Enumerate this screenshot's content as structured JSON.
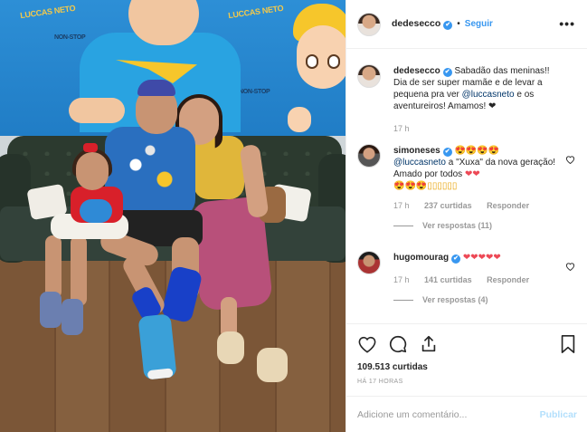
{
  "photo": {
    "banner_words": [
      "LUCCAS NETO",
      "NON-STOP",
      "LUCCAS NETO",
      "NON-STOP"
    ]
  },
  "header": {
    "username": "dedesecco",
    "verified": "✔",
    "separator": "•",
    "follow_label": "Seguir",
    "more_label": "•••"
  },
  "caption": {
    "username": "dedesecco",
    "verified": "✔",
    "text_1": "Sabadão das meninas!! Dia de ser super mamãe e de levar a pequena pra ver ",
    "mention": "@luccasneto",
    "text_2": " e os aventureiros! Amamos! ",
    "emoji": "❤",
    "time": "17 h"
  },
  "comments": [
    {
      "username": "simoneses",
      "verified": "✔",
      "emoji_lead": "😍😍😍😍",
      "mention": "@luccasneto",
      "text": " a \"Xuxa\" da nova geração! Amado por todos ",
      "emoji_hearts": "❤❤",
      "emoji_tail": "😍😍😍▯▯▯▯▯▯",
      "time": "17 h",
      "likes": "237 curtidas",
      "reply_label": "Responder",
      "view_replies": "Ver respostas (11)"
    },
    {
      "username": "hugomourag",
      "verified": "✔",
      "emoji_hearts": "❤❤❤❤❤",
      "time": "17 h",
      "likes": "141 curtidas",
      "reply_label": "Responder",
      "view_replies": "Ver respostas (4)"
    }
  ],
  "actions": {
    "like_icon": "heart-icon",
    "comment_icon": "comment-icon",
    "share_icon": "share-icon",
    "save_icon": "bookmark-icon",
    "likes_count": "109.513 curtidas",
    "date": "HÁ 17 HORAS"
  },
  "add_comment": {
    "placeholder": "Adicione um comentário...",
    "publish_label": "Publicar"
  },
  "colors": {
    "link": "#3897f0",
    "mention": "#003569",
    "muted": "#999999",
    "heart": "#ed4956",
    "publish_disabled": "#b2dffc"
  }
}
